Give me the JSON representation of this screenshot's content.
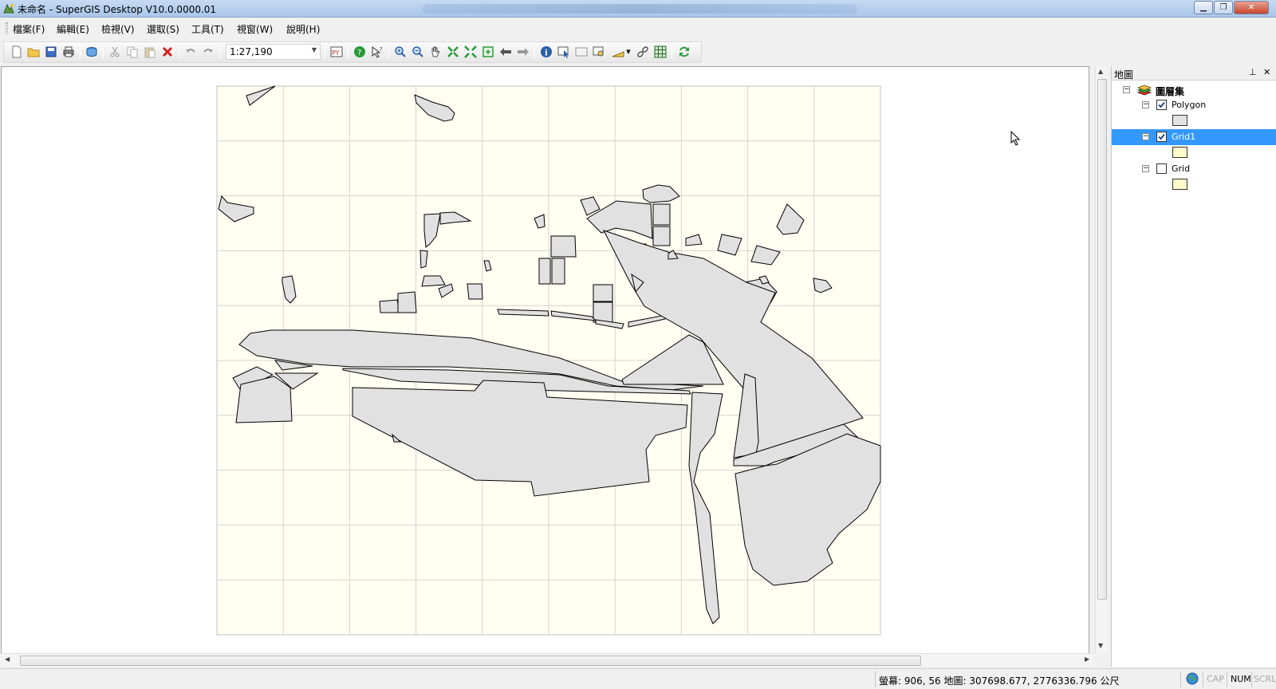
{
  "window": {
    "title": "未命名 - SuperGIS Desktop V10.0.0000.01",
    "minimize": "0",
    "maximize": "1",
    "close": "✕"
  },
  "menu": {
    "file": "檔案(F)",
    "edit": "編輯(E)",
    "view": "檢視(V)",
    "select": "選取(S)",
    "tools": "工具(T)",
    "window": "視窗(W)",
    "help": "說明(H)"
  },
  "toolbar": {
    "scale_value": "1:27,190",
    "icons": [
      "new-document-icon",
      "open-folder-icon",
      "save-icon",
      "print-icon",
      "add-data-icon",
      "cut-icon",
      "copy-icon",
      "paste-icon",
      "delete-icon",
      "undo-icon",
      "redo-icon",
      "python-icon",
      "help-icon",
      "whats-this-icon",
      "zoom-in-icon",
      "zoom-out-icon",
      "pan-icon",
      "fixed-zoom-in-icon",
      "fixed-zoom-out-icon",
      "full-extent-icon",
      "previous-extent-icon",
      "next-extent-icon",
      "identify-icon",
      "select-features-icon",
      "clear-selection-icon",
      "map-tips-icon",
      "measure-icon",
      "hyperlink-icon",
      "overview-icon",
      "refresh-icon"
    ]
  },
  "toc": {
    "title": "地圖",
    "root_label": "圖層集",
    "layers": [
      {
        "name": "Polygon",
        "checked": true,
        "swatch_color": "#e1e1e1",
        "selected": false
      },
      {
        "name": "Grid1",
        "checked": true,
        "swatch_color": "#fffcc9",
        "selected": true
      },
      {
        "name": "Grid",
        "checked": false,
        "swatch_color": "#fffcc9",
        "selected": false
      }
    ]
  },
  "map": {
    "background_color": "#fffff2",
    "grid_line_color": "#d3d3d3",
    "polygon_fill": "#e1e1e1",
    "polygon_stroke": "#000000",
    "grid_columns": 10,
    "grid_rows": 10
  },
  "status": {
    "coords": "螢幕: 906, 56  地圖: 307698.677, 2776336.796 公尺",
    "cap": "CAP",
    "num": "NUM",
    "scrl": "SCRL"
  }
}
